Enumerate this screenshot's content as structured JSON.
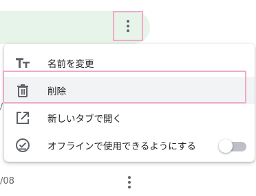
{
  "background_row": {
    "highlight_color": "#e6f4ea",
    "date_fragment": "/08",
    "left_fragment": "/"
  },
  "menu": {
    "items": [
      {
        "label": "名前を変更",
        "icon": "text-format-icon"
      },
      {
        "label": "削除",
        "icon": "trash-icon"
      },
      {
        "label": "新しいタブで開く",
        "icon": "open-in-new-icon"
      },
      {
        "label": "オフラインで使用できるようにする",
        "icon": "offline-pin-icon",
        "toggle": false
      }
    ],
    "selected_index": 1
  }
}
